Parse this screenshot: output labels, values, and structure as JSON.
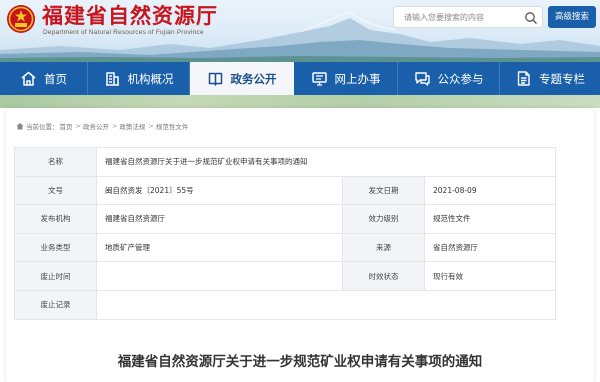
{
  "header": {
    "title": "福建省自然资源厅",
    "subtitle": "Department of Natural Resources of Fujian Province",
    "search_placeholder": "请输入您要搜索的内容",
    "advanced_search": "高级搜索"
  },
  "nav": {
    "items": [
      {
        "label": "首页",
        "icon": "home-icon"
      },
      {
        "label": "机构概况",
        "icon": "building-icon"
      },
      {
        "label": "政务公开",
        "icon": "book-icon",
        "active": true
      },
      {
        "label": "网上办事",
        "icon": "monitor-icon"
      },
      {
        "label": "公众参与",
        "icon": "chat-icon"
      },
      {
        "label": "专题专栏",
        "icon": "document-icon"
      }
    ]
  },
  "breadcrumb": {
    "prefix": "当前位置：",
    "items": [
      "首页",
      "政务公开",
      "政策法规",
      "规范性文件"
    ],
    "separator": ">"
  },
  "info": {
    "name_label": "名称",
    "name_value": "福建省自然资源厅关于进一步规范矿业权申请有关事项的通知",
    "doc_no_label": "文号",
    "doc_no_value": "闽自然资发〔2021〕55号",
    "issue_date_label": "发文日期",
    "issue_date_value": "2021-08-09",
    "issuer_label": "发布机构",
    "issuer_value": "福建省自然资源厅",
    "level_label": "效力级别",
    "level_value": "规范性文件",
    "category_label": "业务类型",
    "category_value": "地质矿产管理",
    "source_label": "来源",
    "source_value": "省自然资源厅",
    "abolish_label": "废止时间",
    "abolish_value": "",
    "status_label": "时效状态",
    "status_value": "现行有效",
    "record_label": "废止记录",
    "record_value": ""
  },
  "document": {
    "title": "福建省自然资源厅关于进一步规范矿业权申请有关事项的通知"
  },
  "colors": {
    "brand_red": "#c8151d",
    "nav_blue": "#1a5fa9",
    "active_text": "#1a4f8f"
  }
}
